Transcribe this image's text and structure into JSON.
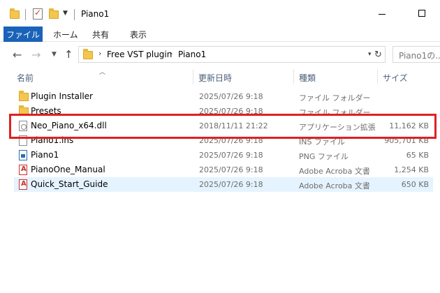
{
  "window": {
    "title": "Piano1"
  },
  "ribbon": {
    "tabs": [
      "ファイル",
      "ホーム",
      "共有",
      "表示"
    ]
  },
  "address": {
    "crumbs": [
      "Free VST plugin",
      "Piano1"
    ],
    "search_placeholder": "Piano1の..."
  },
  "columns": {
    "name": "名前",
    "date": "更新日時",
    "type": "種類",
    "size": "サイズ"
  },
  "files": [
    {
      "name": "Plugin Installer",
      "date": "2025/07/26 9:18",
      "type": "ファイル フォルダー",
      "size": "",
      "icon": "folder-icon"
    },
    {
      "name": "Presets",
      "date": "2025/07/26 9:18",
      "type": "ファイル フォルダー",
      "size": "",
      "icon": "folder-icon"
    },
    {
      "name": "Neo_Piano_x64.dll",
      "date": "2018/11/11 21:22",
      "type": "アプリケーション拡張",
      "size": "11,162 KB",
      "icon": "dll-file-icon"
    },
    {
      "name": "Piano1.ins",
      "date": "2025/07/26 9:18",
      "type": "INS ファイル",
      "size": "905,701 KB",
      "icon": "file-icon"
    },
    {
      "name": "Piano1",
      "date": "2025/07/26 9:18",
      "type": "PNG ファイル",
      "size": "65 KB",
      "icon": "png-file-icon"
    },
    {
      "name": "PianoOne_Manual",
      "date": "2025/07/26 9:18",
      "type": "Adobe Acroba 文書",
      "size": "1,254 KB",
      "icon": "pdf-file-icon"
    },
    {
      "name": "Quick_Start_Guide",
      "date": "2025/07/26 9:18",
      "type": "Adobe Acroba 文書",
      "size": "650 KB",
      "icon": "pdf-file-icon"
    }
  ],
  "colors": {
    "file_tab": "#1a63b8",
    "selection": "#e5f3ff",
    "highlight_box": "#e02020"
  }
}
